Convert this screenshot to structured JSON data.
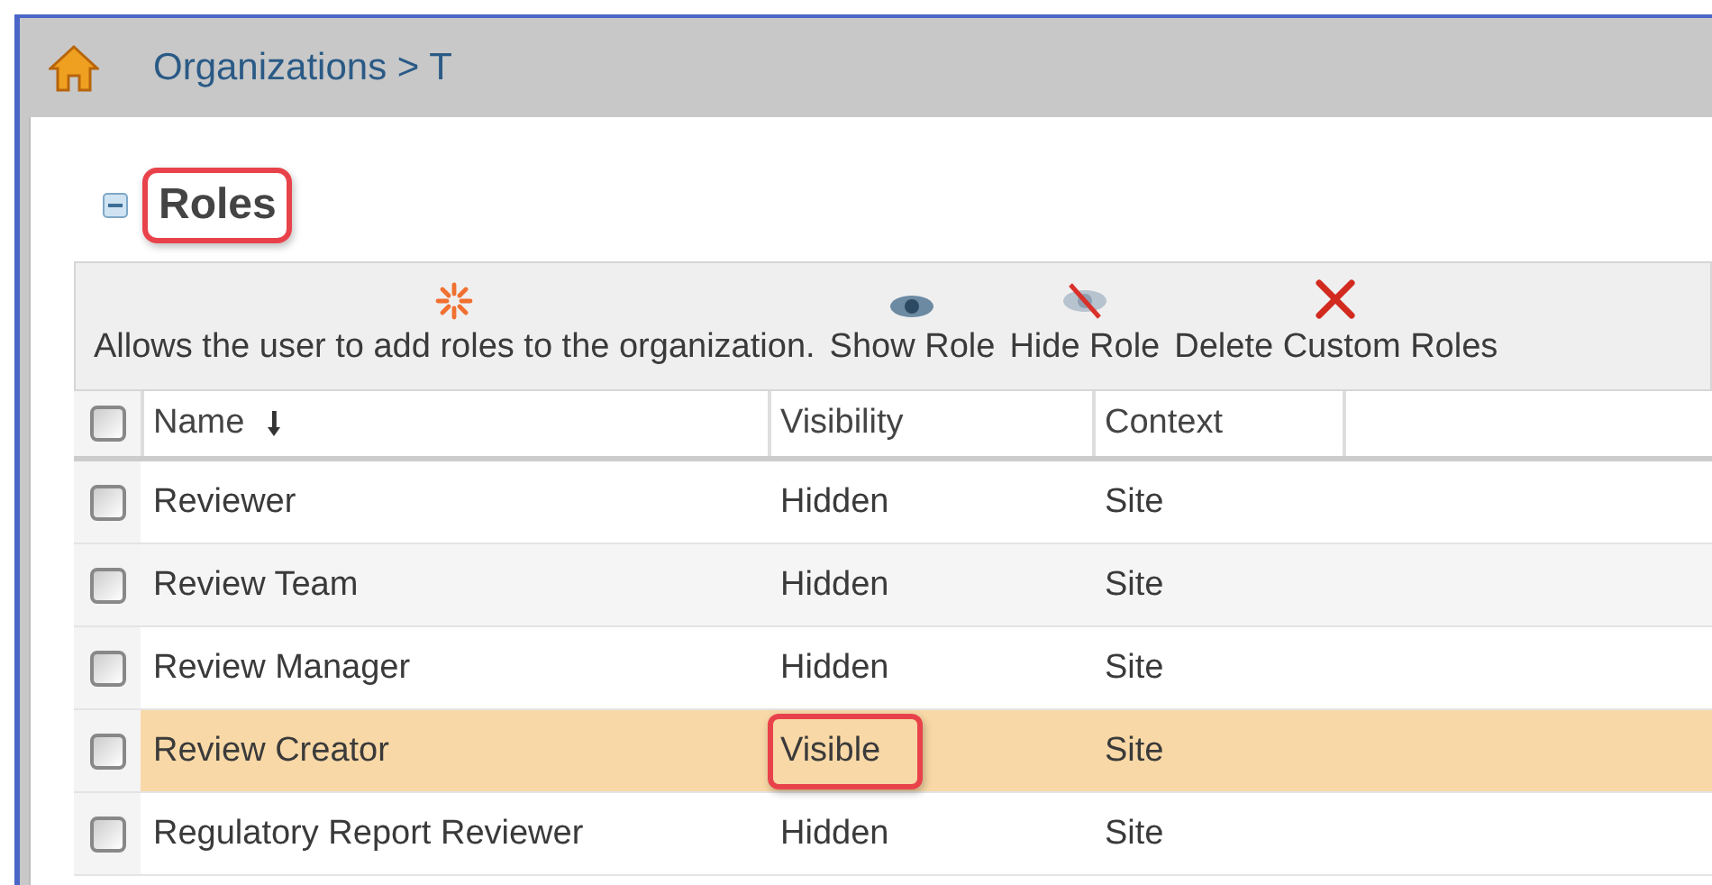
{
  "breadcrumb": "Organizations > T",
  "section": {
    "title": "Roles",
    "expanded": true,
    "highlighted": true
  },
  "toolbar": [
    {
      "kind": "add",
      "label": "Allows the user to add roles to the organization."
    },
    {
      "kind": "show",
      "label": "Show Role"
    },
    {
      "kind": "hide",
      "label": "Hide Role"
    },
    {
      "kind": "delete",
      "label": "Delete Custom Roles"
    }
  ],
  "table": {
    "select_all": false,
    "columns": [
      "Name",
      "Visibility",
      "Context"
    ],
    "rows": [
      {
        "name": "Reviewer",
        "visibility": "Hidden",
        "context": "Site",
        "checked": false,
        "selected": false,
        "highlighted": false
      },
      {
        "name": "Review Team",
        "visibility": "Hidden",
        "context": "Site",
        "checked": false,
        "selected": false,
        "highlighted": false
      },
      {
        "name": "Review Manager",
        "visibility": "Hidden",
        "context": "Site",
        "checked": false,
        "selected": false,
        "highlighted": false
      },
      {
        "name": "Review Creator",
        "visibility": "Visible",
        "context": "Site",
        "checked": false,
        "selected": true,
        "highlighted": true
      },
      {
        "name": "Regulatory Report Reviewer",
        "visibility": "Hidden",
        "context": "Site",
        "checked": false,
        "selected": false,
        "highlighted": false
      }
    ]
  }
}
